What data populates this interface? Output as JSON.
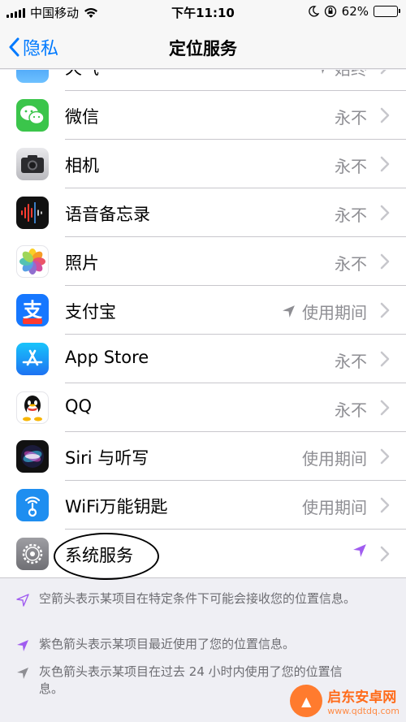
{
  "status_bar": {
    "carrier": "中国移动",
    "time": "下午11:10",
    "battery_percent": "62%",
    "battery_level": 0.62,
    "icons": [
      "signal-icon",
      "wifi-icon",
      "moon-icon",
      "orientation-lock-icon",
      "battery-icon"
    ]
  },
  "nav": {
    "back_label": "隐私",
    "title": "定位服务"
  },
  "rows": [
    {
      "label": "天气",
      "value": "始终",
      "icon": "weather-app-icon",
      "arrow": "gray"
    },
    {
      "label": "微信",
      "value": "永不",
      "icon": "wechat-app-icon"
    },
    {
      "label": "相机",
      "value": "永不",
      "icon": "camera-app-icon"
    },
    {
      "label": "语音备忘录",
      "value": "永不",
      "icon": "voice-memos-app-icon"
    },
    {
      "label": "照片",
      "value": "永不",
      "icon": "photos-app-icon"
    },
    {
      "label": "支付宝",
      "value": "使用期间",
      "icon": "alipay-app-icon",
      "arrow": "gray"
    },
    {
      "label": "App Store",
      "value": "永不",
      "icon": "app-store-app-icon"
    },
    {
      "label": "QQ",
      "value": "永不",
      "icon": "qq-app-icon"
    },
    {
      "label": "Siri 与听写",
      "value": "使用期间",
      "icon": "siri-app-icon"
    },
    {
      "label": "WiFi万能钥匙",
      "value": "使用期间",
      "icon": "wifi-key-app-icon"
    },
    {
      "label": "系统服务",
      "value": "",
      "icon": "settings-gear-app-icon",
      "arrow": "purple"
    }
  ],
  "notes": [
    {
      "text": "空箭头表示某项目在特定条件下可能会接收您的位置信息。",
      "arrow": "hollow-purple"
    },
    {
      "text": "紫色箭头表示某项目最近使用了您的位置信息。",
      "arrow": "purple"
    },
    {
      "text": "灰色箭头表示某项目在过去 24 小时内使用了您的位置信息。",
      "arrow": "gray"
    }
  ],
  "watermark": {
    "name": "启东安卓网",
    "url": "www.qdtdq.com"
  },
  "colors": {
    "accent": "#007aff",
    "purple_arrow": "#a05cf0",
    "gray_arrow": "#8e8e93"
  }
}
